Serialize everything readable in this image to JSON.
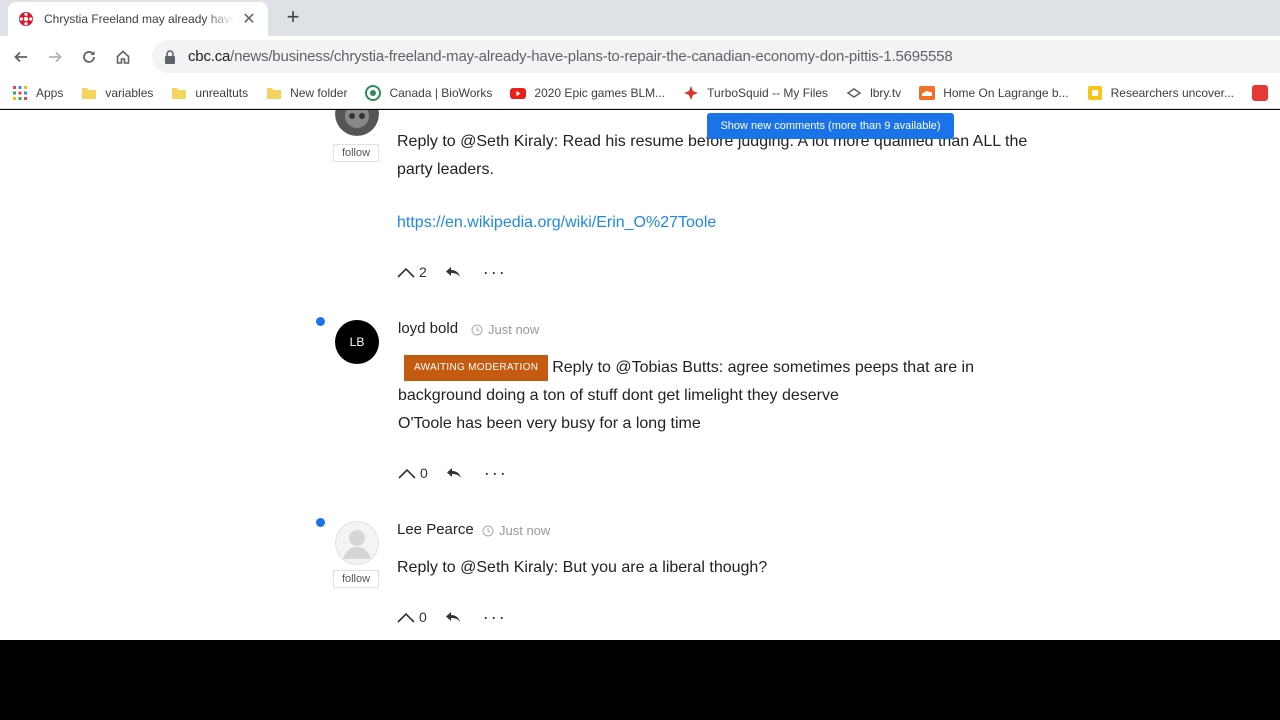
{
  "browser": {
    "tab_title": "Chrystia Freeland may already have plans to repair the Canadian economy",
    "tab_close": "✕",
    "new_tab": "+",
    "url_host": "cbc.ca",
    "url_path": "/news/business/chrystia-freeland-may-already-have-plans-to-repair-the-canadian-economy-don-pittis-1.5695558"
  },
  "bookmarks": [
    {
      "label": "Apps",
      "icon": "apps-grid-icon"
    },
    {
      "label": "variables",
      "icon": "folder-icon"
    },
    {
      "label": "unrealtuts",
      "icon": "folder-icon"
    },
    {
      "label": "New folder",
      "icon": "folder-icon"
    },
    {
      "label": "Canada | BioWorks",
      "icon": "bioworks-icon"
    },
    {
      "label": "2020 Epic games BLM...",
      "icon": "youtube-icon"
    },
    {
      "label": "TurboSquid -- My Files",
      "icon": "turbosquid-icon"
    },
    {
      "label": "lbry.tv",
      "icon": "lbry-icon"
    },
    {
      "label": "Home On Lagrange b...",
      "icon": "soundcloud-icon"
    },
    {
      "label": "Researchers uncover...",
      "icon": "bookmark-yellow-icon"
    }
  ],
  "colors": {
    "accent_blue": "#1a73e8",
    "moderation_badge": "#c55a11",
    "link_blue": "#1e88e5"
  },
  "banner": {
    "new_comments": "Show new comments (more than 9 available)"
  },
  "comments": [
    {
      "follow": "follow",
      "text_line1": "Reply to @Seth Kiraly: Read his resume before judging. A lot more qualified than ALL the",
      "text_line2": "party leaders.",
      "link": "https://en.wikipedia.org/wiki/Erin_O%27Toole",
      "upvotes": "2"
    },
    {
      "author": "loyd bold",
      "initials": "LB",
      "time": "Just now",
      "badge": "AWAITING MODERATION",
      "text_line1": "Reply to @Tobias Butts: agree sometimes peeps that are in",
      "text_line2": "background doing a ton of stuff dont get limelight they deserve",
      "text_line3": "O'Toole has been very busy for a long time",
      "upvotes": "0"
    },
    {
      "author": "Lee Pearce",
      "time": "Just now",
      "follow": "follow",
      "text_line1": "Reply to @Seth Kiraly: But you are a liberal though?",
      "upvotes": "0"
    }
  ],
  "more_glyph": "···"
}
